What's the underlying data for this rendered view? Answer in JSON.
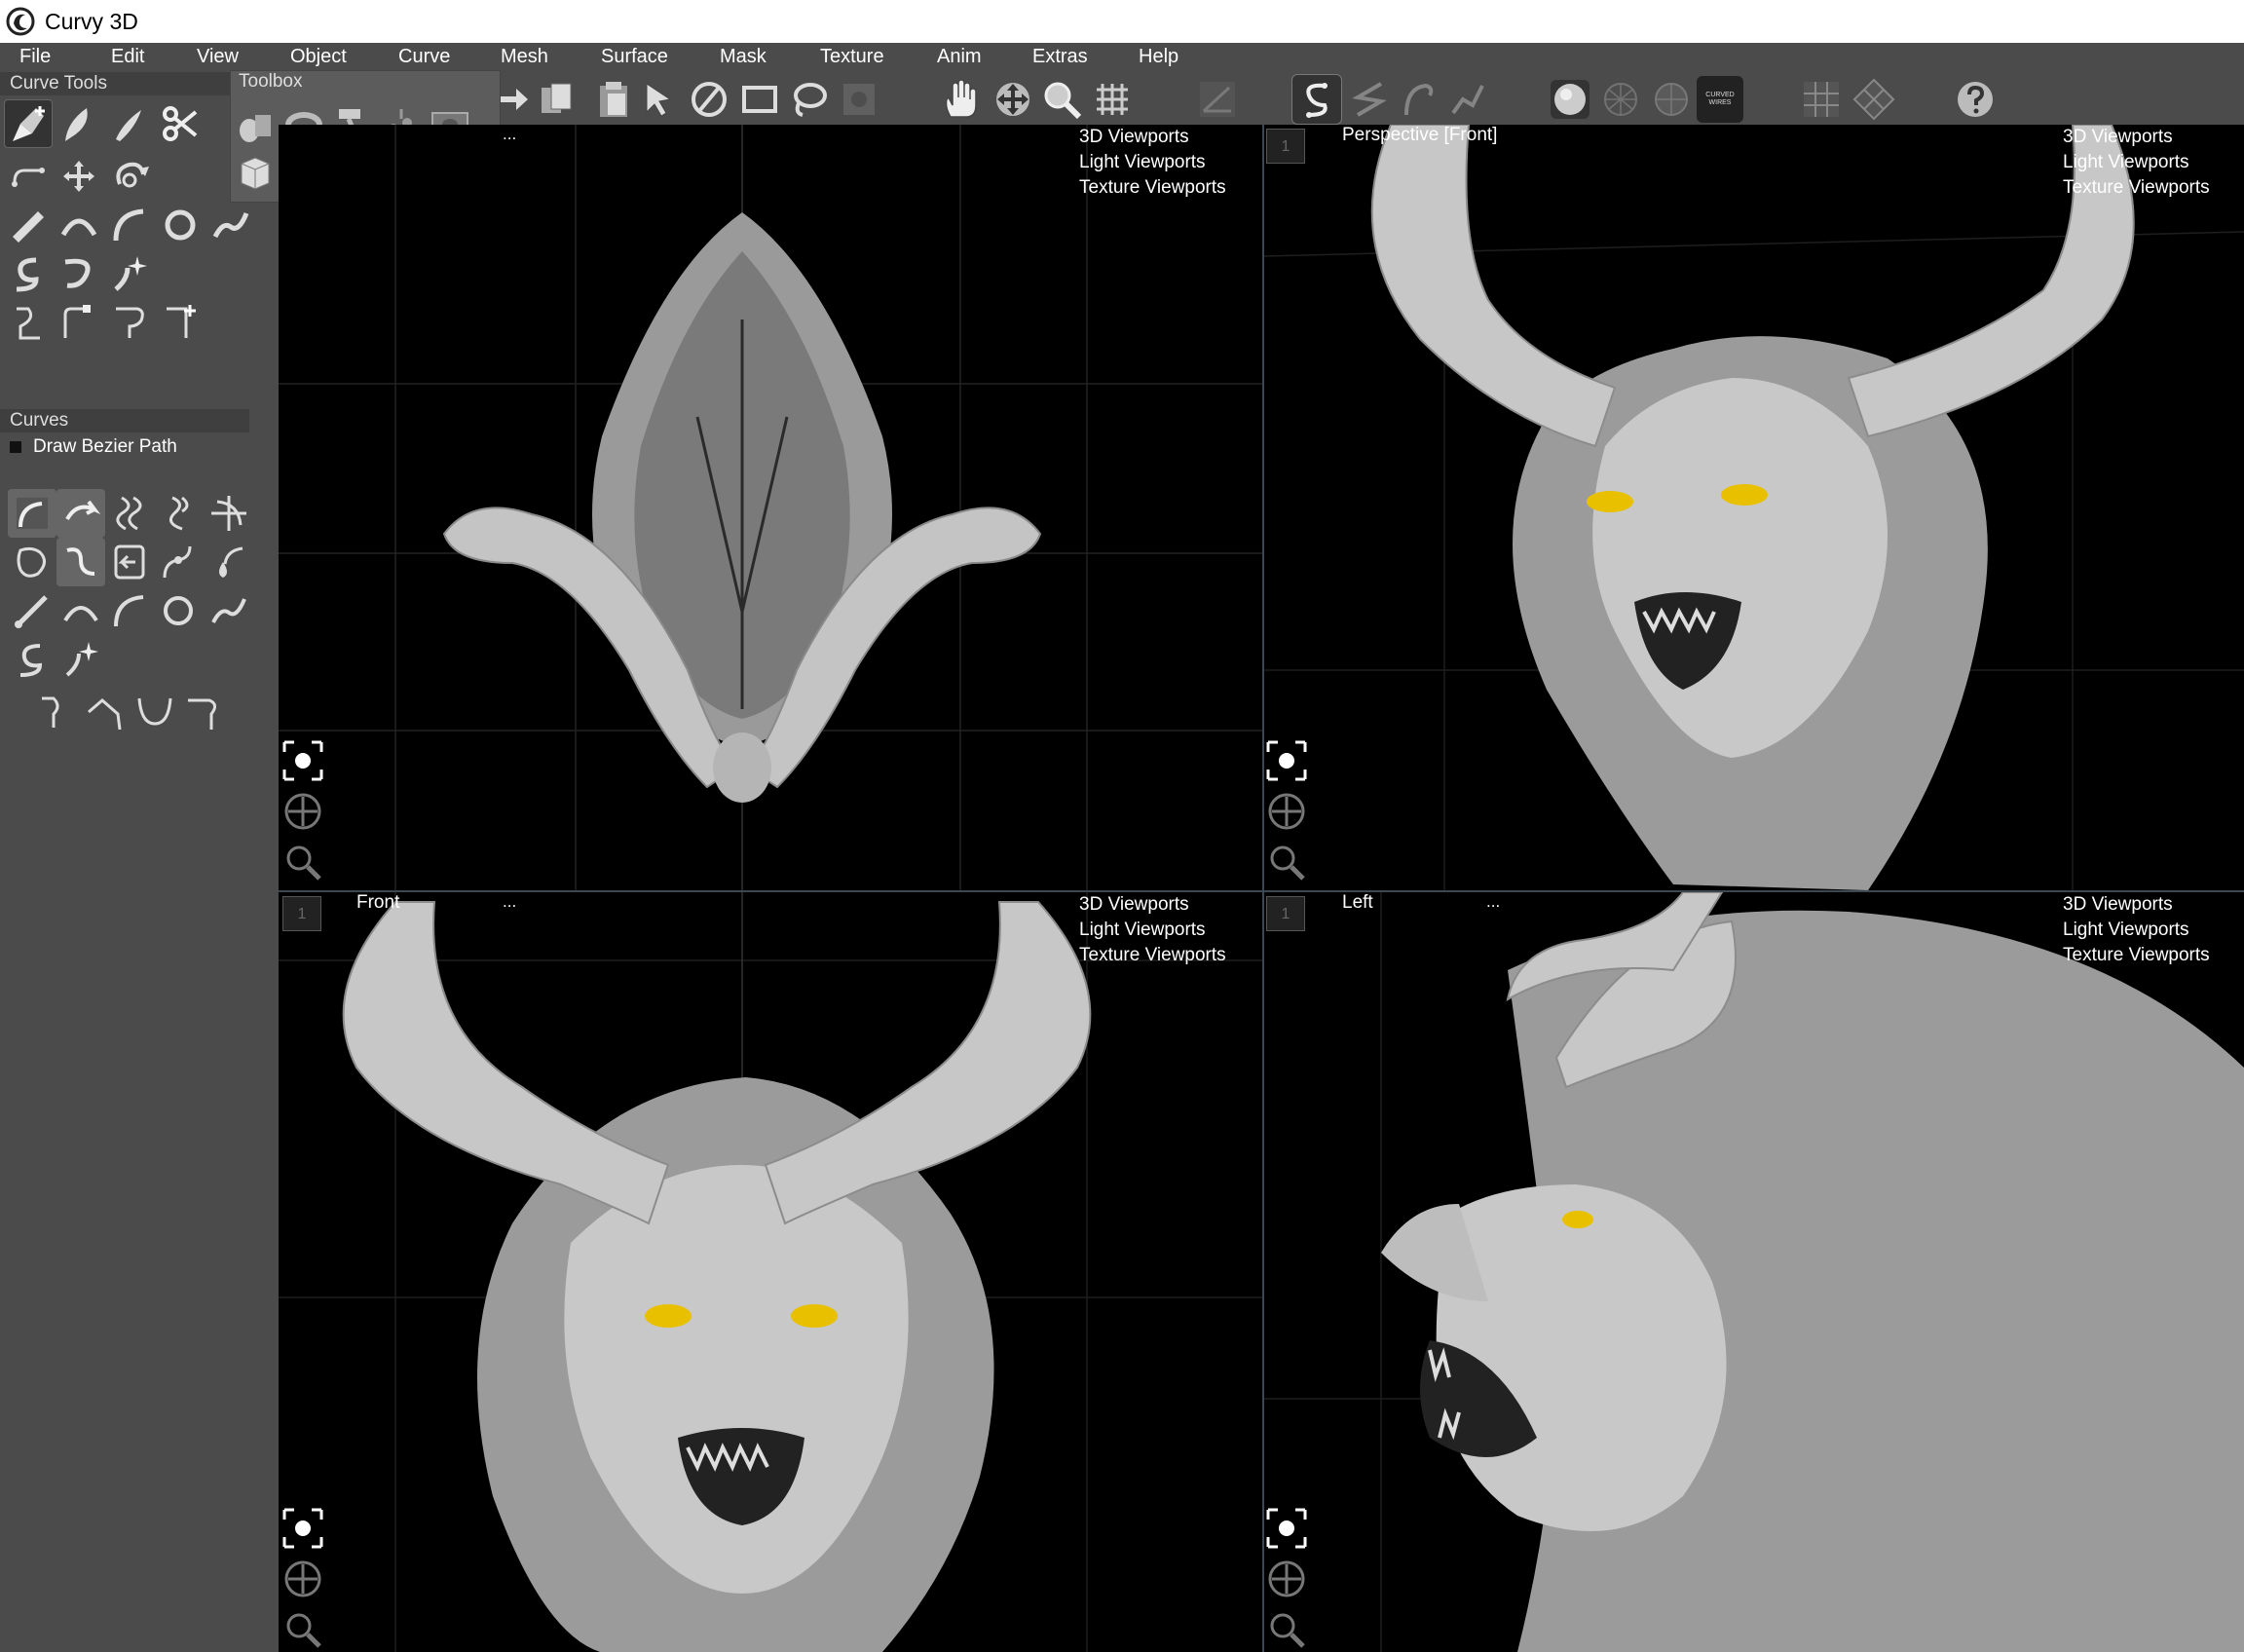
{
  "window": {
    "title": "Curvy 3D"
  },
  "menu": [
    "File",
    "Edit",
    "View",
    "Object",
    "Curve",
    "Mesh",
    "Surface",
    "Mask",
    "Texture",
    "Anim",
    "Extras",
    "Help"
  ],
  "toolbar": {
    "curved_wires_label": "CURVED WIRES"
  },
  "panels": {
    "curve_tools": "Curve Tools",
    "toolbox": "Toolbox",
    "curves": "Curves",
    "curves_active_item": "Draw Bezier Path"
  },
  "viewports": {
    "top_left": {
      "title": "",
      "dots": "...",
      "num": "",
      "menu": [
        "3D Viewports",
        "Light Viewports",
        "Texture Viewports"
      ]
    },
    "top_right": {
      "title": "Perspective [Front]",
      "dots": "",
      "num": "1",
      "menu": [
        "3D Viewports",
        "Light Viewports",
        "Texture Viewports"
      ]
    },
    "bottom_left": {
      "title": "Front",
      "dots": "...",
      "num": "1",
      "menu": [
        "3D Viewports",
        "Light Viewports",
        "Texture Viewports"
      ]
    },
    "bottom_right": {
      "title": "Left",
      "dots": "...",
      "num": "1",
      "menu": [
        "3D Viewports",
        "Light Viewports",
        "Texture Viewports"
      ]
    }
  },
  "colors": {
    "eye": "#e8c000",
    "panel": "#4b4b4b",
    "model": "#b9b9b9"
  }
}
